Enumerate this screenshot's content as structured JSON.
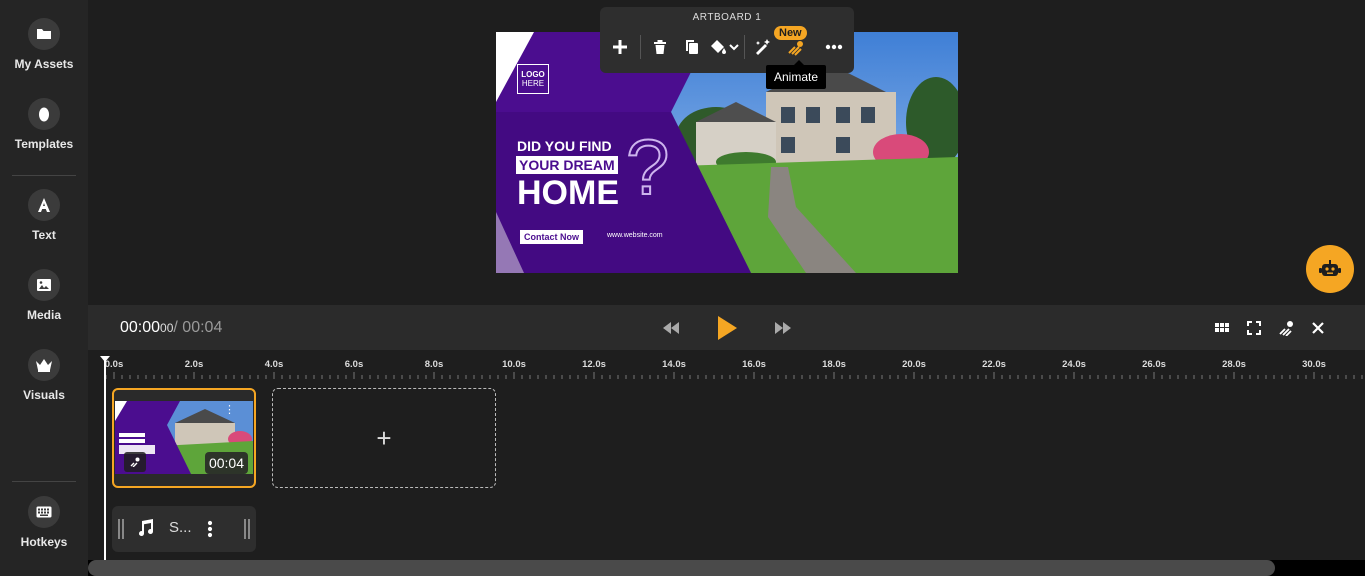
{
  "sidebar": {
    "items": [
      {
        "label": "My Assets",
        "icon": "folder-icon"
      },
      {
        "label": "Templates",
        "icon": "templates-icon"
      },
      {
        "label": "Text",
        "icon": "text-icon"
      },
      {
        "label": "Media",
        "icon": "image-icon"
      },
      {
        "label": "Visuals",
        "icon": "crown-icon"
      },
      {
        "label": "Hotkeys",
        "icon": "keyboard-icon"
      }
    ]
  },
  "toolbar": {
    "title": "ARTBOARD 1",
    "new_badge": "New",
    "tooltip": "Animate"
  },
  "artboard": {
    "logo_line1": "LOGO",
    "logo_line2": "HERE",
    "headline1": "DID YOU FIND",
    "headline2": "YOUR DREAM",
    "headline3": "HOME",
    "question": "?",
    "cta": "Contact Now",
    "website": "www.website.com"
  },
  "playback": {
    "current": "00:00",
    "frames": "00",
    "total": "/ 00:04"
  },
  "timeline": {
    "ticks": [
      "0.0s",
      "2.0s",
      "4.0s",
      "6.0s",
      "8.0s",
      "10.0s",
      "12.0s",
      "14.0s",
      "16.0s",
      "18.0s",
      "20.0s",
      "22.0s",
      "24.0s",
      "26.0s",
      "28.0s",
      "30.0s"
    ],
    "clip_duration": "00:04",
    "add_label": "+",
    "audio_label": "S..."
  },
  "colors": {
    "accent": "#f5a623",
    "purple": "#4b0d8f"
  }
}
